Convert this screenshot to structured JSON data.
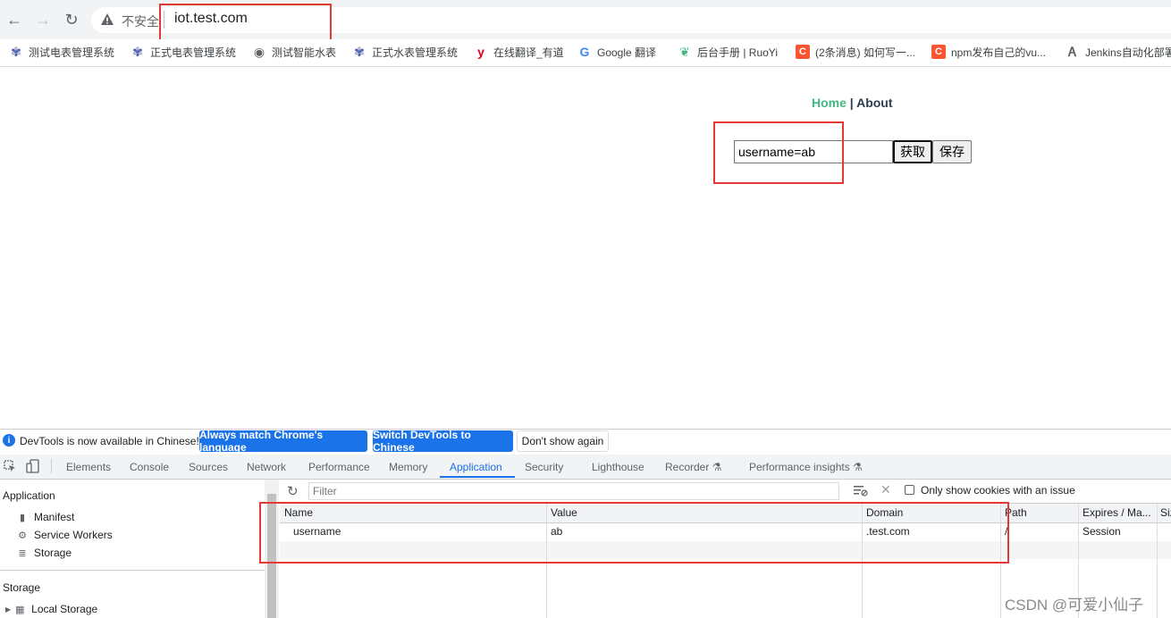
{
  "browser": {
    "insecure_label": "不安全",
    "url": "iot.test.com"
  },
  "bookmarks": [
    {
      "label": "测试电表管理系统",
      "icon": "lotus-icon",
      "color": "#4a5aa8"
    },
    {
      "label": "正式电表管理系统",
      "icon": "lotus-icon",
      "color": "#4a5aa8"
    },
    {
      "label": "测试智能水表",
      "icon": "globe-icon",
      "color": "#5f6368"
    },
    {
      "label": "正式水表管理系统",
      "icon": "lotus-icon",
      "color": "#4a5aa8"
    },
    {
      "label": "在线翻译_有道",
      "icon": "youdao-icon",
      "color": "#e0001b"
    },
    {
      "label": "Google 翻译",
      "icon": "google-translate-icon",
      "color": "#4285f4"
    },
    {
      "label": "后台手册 | RuoYi",
      "icon": "leaf-icon",
      "color": "#42b983"
    },
    {
      "label": "(2条消息) 如何写一...",
      "icon": "csdn-icon",
      "color": "#fc5531"
    },
    {
      "label": "npm发布自己的vu...",
      "icon": "csdn-icon",
      "color": "#fc5531"
    },
    {
      "label": "Jenkins自动化部署",
      "icon": "jenkins-icon",
      "color": "#5f6368"
    }
  ],
  "page": {
    "nav_home": "Home",
    "nav_sep": "|",
    "nav_about": "About",
    "cookie_input_value": "username=ab",
    "get_button": "获取",
    "save_button": "保存"
  },
  "devtools": {
    "info_text": "DevTools is now available in Chinese!",
    "match_lang_button": "Always match Chrome's language",
    "switch_button": "Switch DevTools to Chinese",
    "dont_show_button": "Don't show again",
    "tabs": [
      "Elements",
      "Console",
      "Sources",
      "Network",
      "Performance",
      "Memory",
      "Application",
      "Security",
      "Lighthouse",
      "Recorder",
      "Performance insights"
    ],
    "active_tab": "Application",
    "sidebar": {
      "application_heading": "Application",
      "items": [
        "Manifest",
        "Service Workers",
        "Storage"
      ],
      "storage_heading": "Storage",
      "storage_items": [
        "Local Storage"
      ]
    },
    "filter_placeholder": "Filter",
    "only_issue_label": "Only show cookies with an issue",
    "columns": [
      "Name",
      "Value",
      "Domain",
      "Path",
      "Expires / Ma...",
      "Siz"
    ],
    "rows": [
      {
        "name": "username",
        "value": "ab",
        "domain": ".test.com",
        "path": "/",
        "expires": "Session"
      }
    ]
  },
  "watermark": "CSDN @可爱小仙子"
}
